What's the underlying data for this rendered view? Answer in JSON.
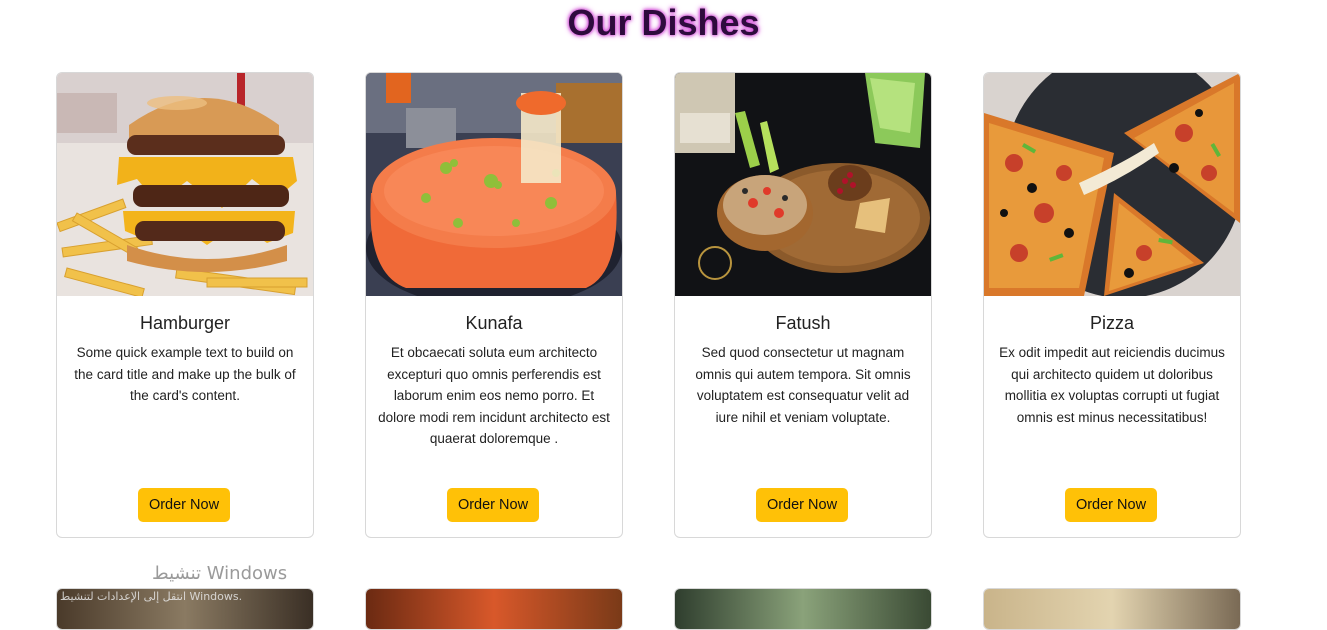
{
  "page": {
    "title": "Our Dishes"
  },
  "dishes": [
    {
      "name": "Hamburger",
      "description": "Some quick example text to build on the card title and make up the bulk of the card's content.",
      "button_label": "Order Now",
      "image_icon": "hamburger-image"
    },
    {
      "name": "Kunafa",
      "description": "Et obcaecati soluta eum architecto excepturi quo omnis perferendis est laborum enim eos nemo porro. Et dolore modi rem incidunt architecto est quaerat doloremque .",
      "button_label": "Order Now",
      "image_icon": "kunafa-image"
    },
    {
      "name": "Fatush",
      "description": "Sed quod consectetur ut magnam omnis qui autem tempora. Sit omnis voluptatem est consequatur velit ad iure nihil et veniam voluptate.",
      "button_label": "Order Now",
      "image_icon": "fatush-image"
    },
    {
      "name": "Pizza",
      "description": "Ex odit impedit aut reiciendis ducimus qui architecto quidem ut doloribus mollitia ex voluptas corrupti ut fugiat omnis est minus necessitatibus!",
      "button_label": "Order Now",
      "image_icon": "pizza-image"
    }
  ],
  "watermark": {
    "text": "تنشيط Windows",
    "subtext": "انتقل إلى الإعدادات لتنشيط Windows."
  },
  "colors": {
    "accent": "#ffc107",
    "title": "#2e0b3d",
    "title_glow": "#d13bd6"
  }
}
